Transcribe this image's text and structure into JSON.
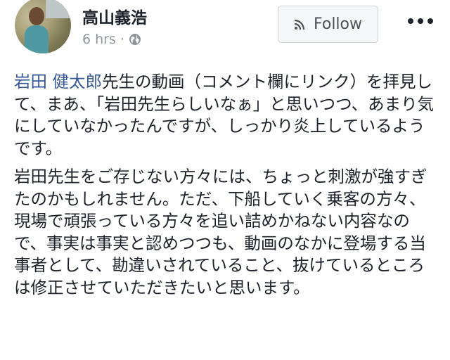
{
  "author": {
    "name": "高山義浩",
    "avatar_icon": "user-photo-avatar"
  },
  "meta": {
    "time": "6 hrs",
    "separator": "·",
    "privacy_icon": "globe-icon"
  },
  "actions": {
    "follow_label": "Follow",
    "follow_icon": "rss-icon",
    "more_icon": "more-dots-icon"
  },
  "post": {
    "p1_mention": "岩田 健太郎",
    "p1_rest": "先生の動画（コメント欄にリンク）を拝見して、まあ、「岩田先生らしいなぁ」と思いつつ、あまり気にしていなかったんですが、しっかり炎上しているようです。",
    "p2": "岩田先生をご存じない方々には、ちょっと刺激が強すぎたのかもしれません。ただ、下船していく乗客の方々、現場で頑張っている方々を追い詰めかねない内容なので、事実は事実と認めつつも、動画のなかに登場する当事者として、勘違いされていること、抜けているところは修正させていただきたいと思います。"
  },
  "colors": {
    "link": "#365899",
    "text": "#1d2129",
    "meta": "#90949c"
  }
}
